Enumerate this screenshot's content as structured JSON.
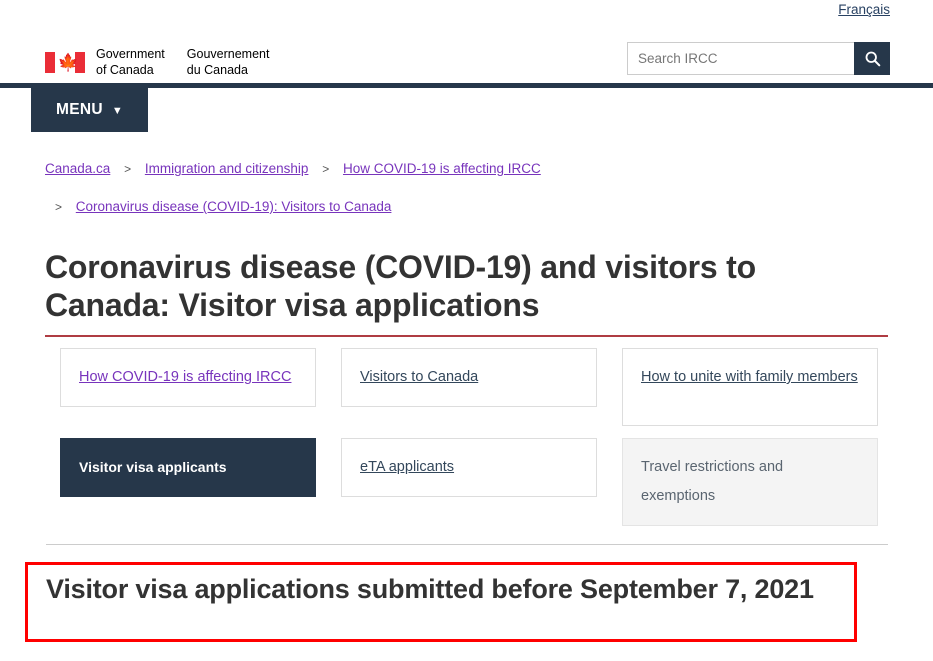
{
  "header": {
    "language_link": "Français",
    "wordmark_en_line1": "Government",
    "wordmark_en_line2": "of Canada",
    "wordmark_fr_line1": "Gouvernement",
    "wordmark_fr_line2": "du Canada",
    "flag_icon": "canada-flag-icon",
    "maple_leaf": "🍁"
  },
  "search": {
    "placeholder": "Search IRCC",
    "value": "",
    "icon": "search-icon",
    "button_color": "#26374a"
  },
  "menu": {
    "label": "MENU",
    "caret_icon": "chevron-down-icon"
  },
  "breadcrumb": {
    "items": [
      {
        "label": "Canada.ca"
      },
      {
        "label": "Immigration and citizenship"
      },
      {
        "label": "How COVID-19 is affecting IRCC"
      },
      {
        "label": "Coronavirus disease (COVID-19): Visitors to Canada"
      }
    ],
    "separator": ">"
  },
  "main": {
    "page_title": "Coronavirus disease (COVID-19) and visitors to Canada: Visitor visa applications",
    "rule_color": "#af3c43",
    "cards": [
      {
        "label": "How COVID-19 is affecting IRCC",
        "state": "visited"
      },
      {
        "label": "Visitors to Canada",
        "state": "link"
      },
      {
        "label": "How to unite with family members",
        "state": "link",
        "tall": true
      },
      {
        "label": "Visitor visa applicants",
        "state": "active"
      },
      {
        "label": "eTA applicants",
        "state": "link"
      },
      {
        "label": "Travel restrictions and exemptions",
        "state": "disabled",
        "tall": true
      }
    ],
    "sub_title": "Visitor visa applications submitted before September 7, 2021",
    "highlight_color": "#ff0000"
  }
}
